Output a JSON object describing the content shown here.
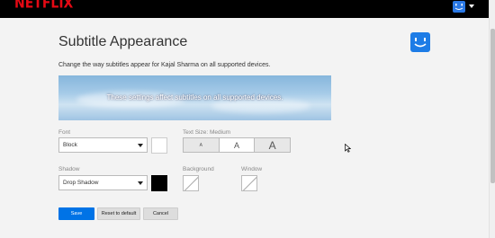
{
  "header": {
    "logo_text": "NETFLIX",
    "brand_color": "#e50914",
    "avatar_icon": "smiley-avatar-icon",
    "menu_icon": "caret-down-icon"
  },
  "page": {
    "title": "Subtitle Appearance",
    "description": "Change the way subtitles appear for Kajal Sharma on all supported devices.",
    "avatar_color": "#1d7ce6"
  },
  "preview": {
    "text": "These settings affect subtitles on all supported devices."
  },
  "font": {
    "label": "Font",
    "selected": "Block",
    "color_swatch": "#ffffff"
  },
  "text_size": {
    "label": "Text Size: Medium",
    "options": [
      "A",
      "A",
      "A"
    ],
    "selected_index": 1
  },
  "shadow": {
    "label": "Shadow",
    "selected": "Drop Shadow",
    "color_swatch": "#000000"
  },
  "background": {
    "label": "Background"
  },
  "window": {
    "label": "Window"
  },
  "actions": {
    "save": "Save",
    "reset": "Reset to default",
    "cancel": "Cancel",
    "accent_color": "#0073e6"
  }
}
